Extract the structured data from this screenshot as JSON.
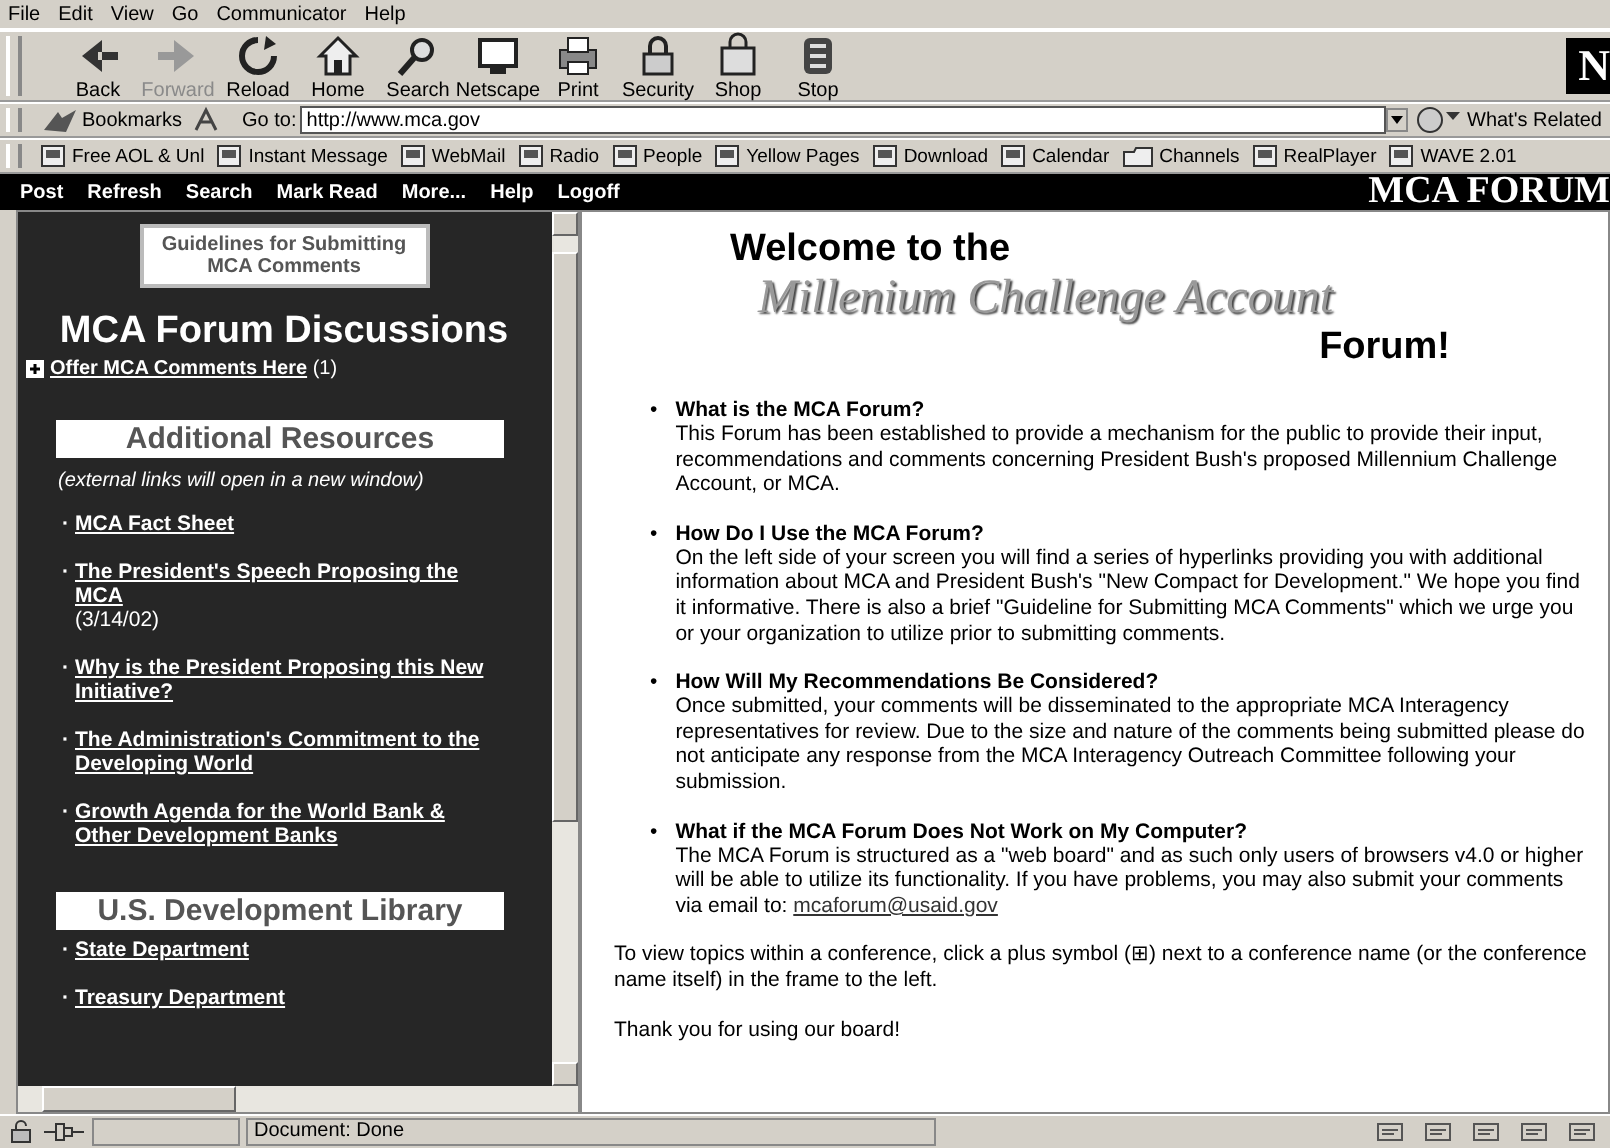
{
  "menu_bar": [
    "File",
    "Edit",
    "View",
    "Go",
    "Communicator",
    "Help"
  ],
  "toolbar": [
    {
      "label": "Back",
      "kind": "back",
      "disabled": false
    },
    {
      "label": "Forward",
      "kind": "forward",
      "disabled": true
    },
    {
      "label": "Reload",
      "kind": "reload",
      "disabled": false
    },
    {
      "label": "Home",
      "kind": "home",
      "disabled": false
    },
    {
      "label": "Search",
      "kind": "search",
      "disabled": false
    },
    {
      "label": "Netscape",
      "kind": "netscape",
      "disabled": false
    },
    {
      "label": "Print",
      "kind": "print",
      "disabled": false
    },
    {
      "label": "Security",
      "kind": "security",
      "disabled": false
    },
    {
      "label": "Shop",
      "kind": "shop",
      "disabled": false
    },
    {
      "label": "Stop",
      "kind": "stop",
      "disabled": false
    }
  ],
  "logo_letter": "N",
  "location_bar": {
    "bookmarks": "Bookmarks",
    "goto_label": "Go to:",
    "url": "http://www.mca.gov",
    "whats_related": "What's Related"
  },
  "personal_toolbar": [
    {
      "label": "Free AOL & Unl",
      "kind": "page"
    },
    {
      "label": "Instant Message",
      "kind": "page"
    },
    {
      "label": "WebMail",
      "kind": "page"
    },
    {
      "label": "Radio",
      "kind": "page"
    },
    {
      "label": "People",
      "kind": "page"
    },
    {
      "label": "Yellow Pages",
      "kind": "page"
    },
    {
      "label": "Download",
      "kind": "page"
    },
    {
      "label": "Calendar",
      "kind": "page"
    },
    {
      "label": "Channels",
      "kind": "channels"
    },
    {
      "label": "RealPlayer",
      "kind": "page"
    },
    {
      "label": "WAVE 2.01",
      "kind": "page"
    }
  ],
  "forum_nav": {
    "items": [
      "Post",
      "Refresh",
      "Search",
      "Mark Read",
      "More...",
      "Help",
      "Logoff"
    ],
    "title": "MCA FORUM"
  },
  "left_frame": {
    "guidelines_button": "Guidelines for Submitting MCA Comments",
    "heading": "MCA Forum Discussions",
    "conference": {
      "link": "Offer MCA Comments Here",
      "count": "(1)"
    },
    "sections": [
      {
        "title": "Additional Resources",
        "note": "(external links will open in a new window)",
        "links": [
          {
            "bullet": "·",
            "text": "MCA Fact Sheet"
          },
          {
            "bullet": "·",
            "text": "The President's Speech Proposing the MCA",
            "suffix": "(3/14/02)"
          },
          {
            "bullet": "·",
            "text": "Why is the President Proposing this New Initiative?"
          },
          {
            "bullet": "·",
            "text": "The Administration's Commitment to the Developing World"
          },
          {
            "bullet": "·",
            "text": "Growth Agenda for the World Bank & Other Development Banks"
          }
        ]
      },
      {
        "title": "U.S. Development Library",
        "links": [
          {
            "bullet": "·",
            "text": "State Department"
          },
          {
            "bullet": "·",
            "text": "Treasury Department"
          }
        ]
      }
    ]
  },
  "right_frame": {
    "welcome": "Welcome to the",
    "program": "Millenium Challenge Account",
    "forum": "Forum!",
    "faq": [
      {
        "bullet": "•",
        "question": "What is the MCA Forum?",
        "answer": "This Forum has been established to provide a mechanism for the public to provide their input, recommendations and comments concerning President Bush's proposed Millennium Challenge Account, or MCA."
      },
      {
        "bullet": "•",
        "question": "How Do I Use the MCA Forum?",
        "answer": "On the left side of your screen you will find a series of hyperlinks providing you with additional information about MCA and President Bush's \"New Compact for Development.\" We hope you find it informative. There is also a brief \"Guideline for Submitting MCA Comments\" which we urge you or your organization to utilize prior to submitting comments."
      },
      {
        "bullet": "•",
        "question": "How Will My Recommendations Be Considered?",
        "answer": "Once submitted, your comments will be disseminated to the appropriate MCA Interagency representatives for review. Due to the size and nature of the comments being submitted please do not anticipate any response from the MCA Interagency Outreach Committee following your submission."
      },
      {
        "bullet": "•",
        "question": "What if the MCA Forum Does Not Work on My Computer?",
        "answer": "The MCA Forum is structured as a \"web board\" and as such only users of browsers v4.0 or higher will be able to utilize its functionality. If you have problems, you may also submit your comments via email to:",
        "email": "mcaforum@usaid.gov"
      }
    ],
    "instructions": "To view topics within a conference, click a plus symbol (⊞) next to a conference name (or the conference name itself) in the frame to the left.",
    "thanks": "Thank you for using our board!"
  },
  "status_bar": {
    "text": "Document: Done"
  }
}
